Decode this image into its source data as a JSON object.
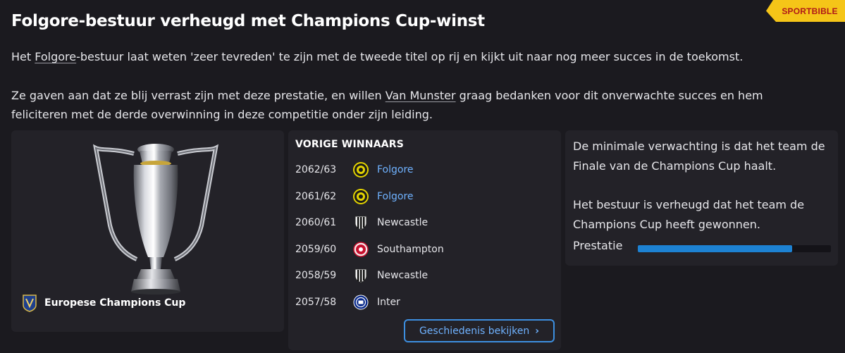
{
  "badge": "SPORTBIBLE",
  "headline": "Folgore-bestuur verheugd met Champions Cup-winst",
  "paragraph1": {
    "prefix": "Het ",
    "club_link": "Folgore",
    "suffix": "-bestuur laat weten 'zeer tevreden' te zijn met de tweede titel op rij en kijkt uit naar nog meer succes in de toekomst."
  },
  "paragraph2": {
    "prefix": "Ze gaven aan dat ze blij verrast zijn met deze prestatie, en willen ",
    "manager_link": "Van Munster",
    "suffix": " graag bedanken voor dit onverwachte succes en hem feliciteren met de derde overwinning in deze competitie onder zijn leiding."
  },
  "trophy": {
    "competition": "Europese Champions Cup",
    "icon": "competition-crest-icon"
  },
  "winners": {
    "title": "VORIGE WINNAARS",
    "rows": [
      {
        "season": "2062/63",
        "team": "Folgore",
        "logo": "folgore-crest-icon",
        "link": true
      },
      {
        "season": "2061/62",
        "team": "Folgore",
        "logo": "folgore-crest-icon",
        "link": true
      },
      {
        "season": "2060/61",
        "team": "Newcastle",
        "logo": "newcastle-crest-icon",
        "link": false
      },
      {
        "season": "2059/60",
        "team": "Southampton",
        "logo": "southampton-crest-icon",
        "link": false
      },
      {
        "season": "2058/59",
        "team": "Newcastle",
        "logo": "newcastle-crest-icon",
        "link": false
      },
      {
        "season": "2057/58",
        "team": "Inter",
        "logo": "inter-crest-icon",
        "link": false
      }
    ],
    "history_button": "Geschiedenis bekijken"
  },
  "expectation": {
    "line1": "De minimale verwachting is dat het team de Finale van de Champions Cup haalt.",
    "line2": "Het bestuur is verheugd dat het team de Champions Cup heeft gewonnen.",
    "performance_label": "Prestatie",
    "performance_value": 0.8
  },
  "colors": {
    "background": "#1b1a1f",
    "panel": "#232228",
    "link": "#6fb2ff",
    "accent": "#1d82d3",
    "badge": "#f5c518"
  }
}
